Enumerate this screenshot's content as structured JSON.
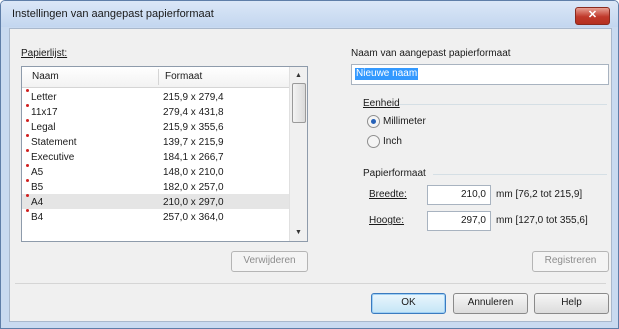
{
  "window": {
    "title": "Instellingen van aangepast papierformaat",
    "close_glyph": "✕"
  },
  "paper_list": {
    "label": "Papierlijst:",
    "columns": [
      "Naam",
      "Formaat"
    ],
    "rows": [
      {
        "name": "Letter",
        "size": "215,9 x 279,4",
        "selected": false
      },
      {
        "name": "11x17",
        "size": "279,4 x 431,8",
        "selected": false
      },
      {
        "name": "Legal",
        "size": "215,9 x 355,6",
        "selected": false
      },
      {
        "name": "Statement",
        "size": "139,7 x 215,9",
        "selected": false
      },
      {
        "name": "Executive",
        "size": "184,1 x 266,7",
        "selected": false
      },
      {
        "name": "A5",
        "size": "148,0 x 210,0",
        "selected": false
      },
      {
        "name": "B5",
        "size": "182,0 x 257,0",
        "selected": false
      },
      {
        "name": "A4",
        "size": "210,0 x 297,0",
        "selected": true
      },
      {
        "name": "B4",
        "size": "257,0 x 364,0",
        "selected": false
      }
    ],
    "delete_button": "Verwijderen"
  },
  "custom_name": {
    "label": "Naam van aangepast papierformaat",
    "value": "Nieuwe naam"
  },
  "unit": {
    "label": "Eenheid",
    "options": [
      {
        "label": "Millimeter",
        "checked": true
      },
      {
        "label": "Inch",
        "checked": false
      }
    ]
  },
  "paper_size": {
    "label": "Papierformaat",
    "width": {
      "label": "Breedte:",
      "value": "210,0",
      "range": "mm [76,2 tot 215,9]"
    },
    "height": {
      "label": "Hoogte:",
      "value": "297,0",
      "range": "mm [127,0 tot 355,6]"
    }
  },
  "buttons": {
    "register": "Registreren",
    "ok": "OK",
    "cancel": "Annuleren",
    "help": "Help"
  }
}
